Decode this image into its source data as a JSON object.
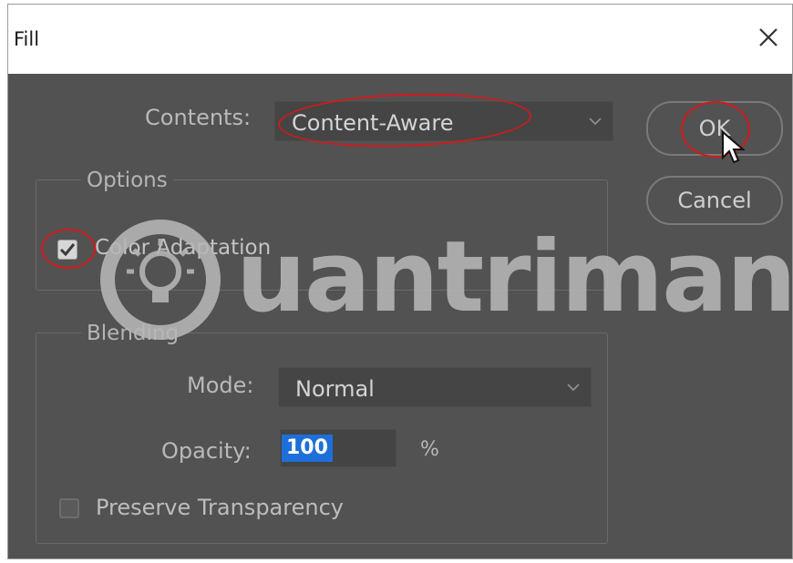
{
  "window": {
    "title": "Fill"
  },
  "contents": {
    "label": "Contents:",
    "value": "Content-Aware"
  },
  "buttons": {
    "ok": "OK",
    "cancel": "Cancel"
  },
  "options": {
    "legend": "Options",
    "color_adaptation": {
      "label": "Color Adaptation",
      "checked": true
    }
  },
  "blending": {
    "legend": "Blending",
    "mode_label": "Mode:",
    "mode_value": "Normal",
    "opacity_label": "Opacity:",
    "opacity_value": "100",
    "opacity_unit": "%",
    "preserve_transparency": {
      "label": "Preserve Transparency",
      "checked": false
    }
  },
  "watermark": {
    "text": "uantrimang"
  },
  "icons": {
    "close": "close-icon",
    "chevron": "chevron-down-icon",
    "check": "check-icon",
    "cursor": "mouse-pointer-icon",
    "watermark_logo": "lightbulb-logo-icon"
  },
  "colors": {
    "dialog_bg": "#525252",
    "titlebar_bg": "#ffffff",
    "annotation_ring": "#d11a1a",
    "selection": "#1e6fd9"
  }
}
